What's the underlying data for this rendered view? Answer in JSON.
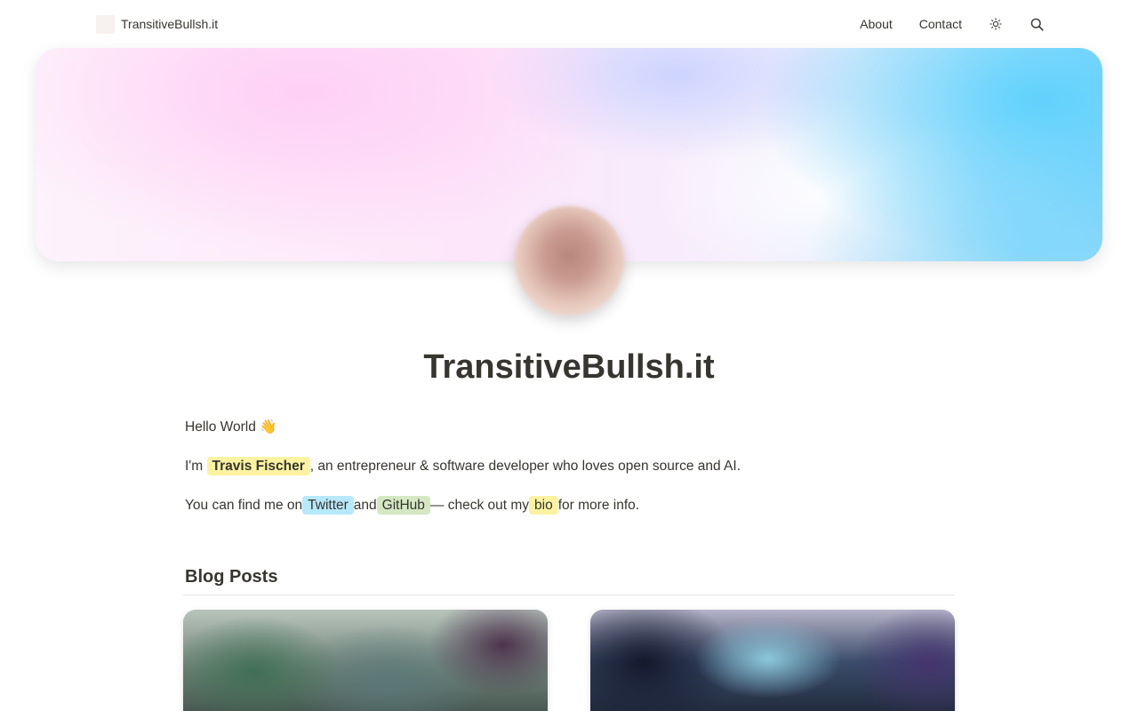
{
  "header": {
    "brand": "TransitiveBullsh.it",
    "nav": [
      "About",
      "Contact"
    ],
    "icons": [
      "sun-icon",
      "search-icon"
    ]
  },
  "hero": {
    "title": "TransitiveBullsh.it"
  },
  "intro": {
    "greeting": "Hello World",
    "greeting_emoji": "👋",
    "line2_prefix": "I'm",
    "name": "Travis Fischer",
    "line2_suffix": ", an entrepreneur & software developer who loves open source and AI.",
    "line3_prefix": "You can find me on",
    "twitter": "Twitter",
    "and": "and",
    "github": "GitHub",
    "line3_mid": "— check out my",
    "bio": "bio",
    "line3_suffix": "for more info."
  },
  "blog": {
    "title": "Blog Posts"
  },
  "colors": {
    "highlight_yellow": "#fbf3a1",
    "highlight_blue": "#b7e8fb",
    "highlight_green": "#d4e8c4",
    "text": "#37352f"
  }
}
